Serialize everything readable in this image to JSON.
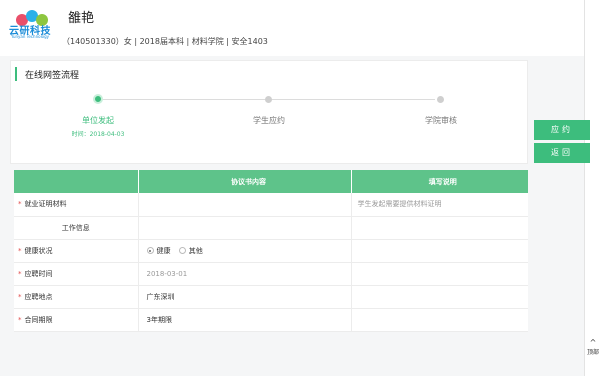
{
  "header": {
    "logo_text": "云研科技",
    "logo_sub": "Yunyan Technology",
    "user_name": "雒艳",
    "user_info": "（140501330）女 | 2018届本科 | 材料学院 | 安全1403"
  },
  "process": {
    "title": "在线网签流程",
    "steps": [
      {
        "label": "单位发起",
        "time": "时间：2018-04-03",
        "active": true
      },
      {
        "label": "学生应约",
        "time": "",
        "active": false
      },
      {
        "label": "学院审核",
        "time": "",
        "active": false
      }
    ]
  },
  "actions": {
    "accept": "应约",
    "back": "返回"
  },
  "back_to_top": {
    "arrow": "^",
    "label": "顶部"
  },
  "table": {
    "headers": [
      "",
      "协议书内容",
      "填写说明"
    ],
    "rows": [
      {
        "label": "就业证明材料",
        "required": true,
        "value": "",
        "note": "学生发起需要提供材料证明"
      },
      {
        "label": "工作信息",
        "required": false,
        "section": true,
        "value": "",
        "note": ""
      },
      {
        "label": "健康状况",
        "required": true,
        "value": "",
        "note": "",
        "radio": [
          "健康",
          "其他"
        ]
      },
      {
        "label": "应聘时间",
        "required": true,
        "value": "2018-03-01",
        "note": "",
        "muted": true
      },
      {
        "label": "应聘地点",
        "required": true,
        "value": "广东深圳",
        "note": ""
      },
      {
        "label": "合同期限",
        "required": true,
        "value": "3年期限",
        "note": ""
      }
    ]
  },
  "colors": {
    "accent": "#3dbd7d",
    "header_bg": "#5ec38a",
    "required": "#e14b4b"
  }
}
